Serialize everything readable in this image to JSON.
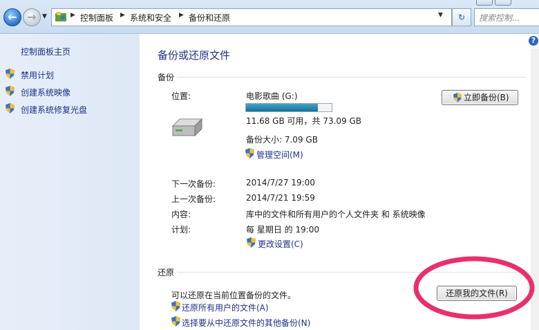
{
  "address_bar": {
    "breadcrumbs": [
      "控制面板",
      "系统和安全",
      "备份和还原"
    ],
    "search_placeholder": "搜索控制..."
  },
  "sidebar": {
    "home_link": "控制面板主页",
    "items": [
      {
        "label": "禁用计划",
        "icon": "uac-shield-icon"
      },
      {
        "label": "创建系统映像",
        "icon": "uac-shield-icon"
      },
      {
        "label": "创建系统修复光盘",
        "icon": "uac-shield-icon"
      }
    ]
  },
  "main": {
    "title": "备份或还原文件",
    "backup": {
      "section_label": "备份",
      "location_label": "位置:",
      "drive_name": "电影歌曲 (G:)",
      "drive_usage_fraction": 0.84,
      "space_text": "11.68 GB 可用，共 73.09 GB",
      "backup_size": "备份大小: 7.09 GB",
      "manage_space_link": "管理空间(M)",
      "backup_now_button": "立即备份(B)",
      "details": [
        {
          "label": "下一次备份:",
          "value": "2014/7/27 19:00"
        },
        {
          "label": "上一次备份:",
          "value": "2014/7/21 19:59"
        },
        {
          "label": "内容:",
          "value": "库中的文件和所有用户的个人文件夹 和 系统映像"
        },
        {
          "label": "计划:",
          "value": "每 星期日 的 19:00"
        }
      ],
      "change_settings_link": "更改设置(C)"
    },
    "restore": {
      "section_label": "还原",
      "description": "可以还原在当前位置备份的文件。",
      "restore_my_files_button": "还原我的文件(R)",
      "restore_all_users_link": "还原所有用户的文件(A)",
      "select_other_backup_link": "选择要从中还原文件的其他备份(N)"
    }
  },
  "colors": {
    "link": "#1e3287",
    "annotation_circle": "#e8306c",
    "meter_fill": "#1b6f98"
  }
}
